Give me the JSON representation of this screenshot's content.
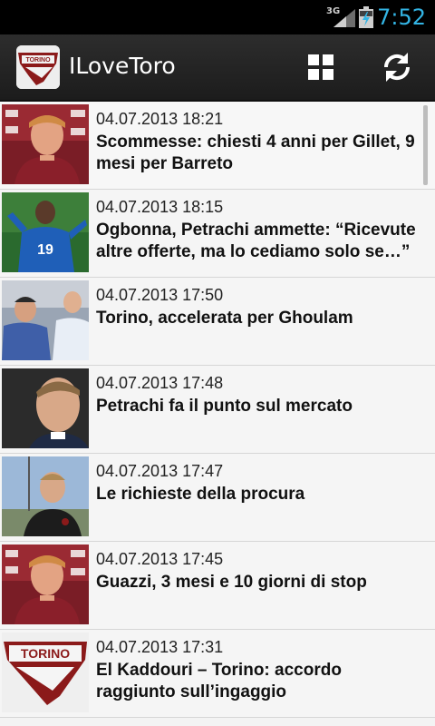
{
  "status": {
    "network": "3G",
    "time": "7:52",
    "colors": {
      "clock": "#33b5e5"
    }
  },
  "actionbar": {
    "title": "ILoveToro",
    "icons": [
      "app-logo-icon",
      "grid-icon",
      "refresh-icon"
    ]
  },
  "news": [
    {
      "date": "04.07.2013 18:21",
      "title": "Scommesse: chiesti 4 anni per Gillet, 9 mesi per Barreto"
    },
    {
      "date": "04.07.2013 18:15",
      "title": "Ogbonna, Petrachi ammette: “Ricevute altre offerte, ma lo cediamo solo se…”"
    },
    {
      "date": "04.07.2013 17:50",
      "title": "Torino, accelerata per Ghoulam"
    },
    {
      "date": "04.07.2013 17:48",
      "title": "Petrachi fa il punto sul mercato"
    },
    {
      "date": "04.07.2013 17:47",
      "title": "Le richieste della procura"
    },
    {
      "date": "04.07.2013 17:45",
      "title": "Guazzi, 3 mesi e 10 giorni di stop"
    },
    {
      "date": "04.07.2013 17:31",
      "title": "El Kaddouri – Torino: accordo raggiunto sull’ingaggio"
    }
  ],
  "logo_text": "TORINO",
  "brand_color": "#8b1a1a"
}
